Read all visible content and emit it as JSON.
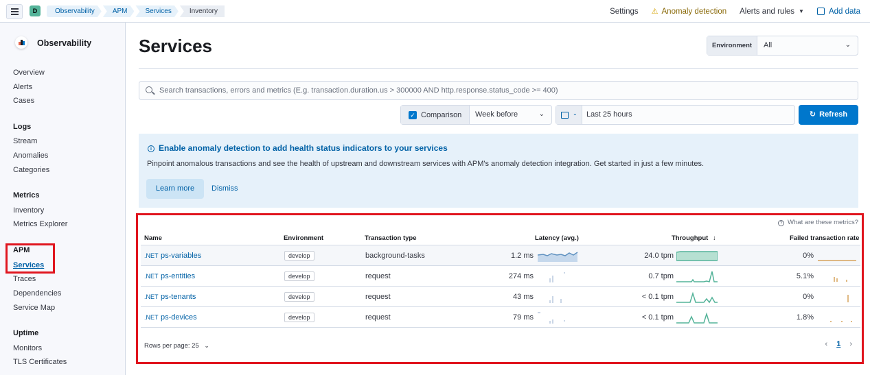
{
  "header": {
    "space_initial": "D",
    "breadcrumbs": [
      "Observability",
      "APM",
      "Services",
      "Inventory"
    ],
    "links": {
      "settings": "Settings",
      "anomaly_detection": "Anomaly detection",
      "alerts_rules": "Alerts and rules",
      "add_data": "Add data"
    }
  },
  "sidebar": {
    "title": "Observability",
    "general": [
      "Overview",
      "Alerts",
      "Cases"
    ],
    "logs": {
      "title": "Logs",
      "items": [
        "Stream",
        "Anomalies",
        "Categories"
      ]
    },
    "metrics": {
      "title": "Metrics",
      "items": [
        "Inventory",
        "Metrics Explorer"
      ]
    },
    "apm": {
      "title": "APM",
      "items": [
        "Services",
        "Traces",
        "Dependencies",
        "Service Map"
      ]
    },
    "uptime": {
      "title": "Uptime",
      "items": [
        "Monitors",
        "TLS Certificates"
      ]
    }
  },
  "page": {
    "title": "Services",
    "environment": {
      "label": "Environment",
      "value": "All"
    },
    "search_placeholder": "Search transactions, errors and metrics (E.g. transaction.duration.us > 300000 AND http.response.status_code >= 400)",
    "comparison": {
      "label": "Comparison",
      "value": "Week before",
      "checked": true
    },
    "date_range": "Last 25 hours",
    "refresh_label": "Refresh"
  },
  "callout": {
    "title": "Enable anomaly detection to add health status indicators to your services",
    "text": "Pinpoint anomalous transactions and see the health of upstream and downstream services with APM's anomaly detection integration. Get started in just a few minutes.",
    "learn_more": "Learn more",
    "dismiss": "Dismiss"
  },
  "table": {
    "help_link": "What are these metrics?",
    "columns": {
      "name": "Name",
      "environment": "Environment",
      "transaction_type": "Transaction type",
      "latency": "Latency (avg.)",
      "throughput": "Throughput",
      "failed_rate": "Failed transaction rate"
    },
    "rows": [
      {
        "agent": ".NET",
        "name": "ps-variables",
        "environment": "develop",
        "transaction_type": "background-tasks",
        "latency": "1.2 ms",
        "throughput": "24.0 tpm",
        "failed_rate": "0%"
      },
      {
        "agent": ".NET",
        "name": "ps-entities",
        "environment": "develop",
        "transaction_type": "request",
        "latency": "274 ms",
        "throughput": "0.7 tpm",
        "failed_rate": "5.1%"
      },
      {
        "agent": ".NET",
        "name": "ps-tenants",
        "environment": "develop",
        "transaction_type": "request",
        "latency": "43 ms",
        "throughput": "< 0.1 tpm",
        "failed_rate": "0%"
      },
      {
        "agent": ".NET",
        "name": "ps-devices",
        "environment": "develop",
        "transaction_type": "request",
        "latency": "79 ms",
        "throughput": "< 0.1 tpm",
        "failed_rate": "1.8%"
      }
    ],
    "rows_per_page": "Rows per page: 25",
    "current_page": "1"
  },
  "colors": {
    "primary": "#0077cc",
    "link": "#0061a6",
    "throughput_spark": "#54b399",
    "failed_spark": "#d6a35c",
    "latency_spark": "#6092c0",
    "highlight_box": "#e0151e"
  }
}
